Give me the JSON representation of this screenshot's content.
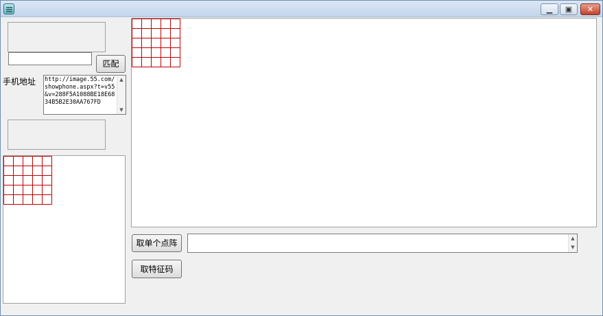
{
  "window": {
    "title": ""
  },
  "controls": {
    "match_button": "匹配",
    "phone_address_label": "手机地址",
    "phone_address_value": "http://image.55.com/showphone.aspx?t=v55&v=288F5A1088BE18E6834B5B2E30AA767FD",
    "top_input_value": "",
    "get_single_matrix_button": "取单个点阵",
    "get_feature_code_button": "取特征码",
    "result_value": ""
  },
  "grids": {
    "main_grid": {
      "rows": 5,
      "cols": 5,
      "color": "#c00000"
    },
    "small_grid": {
      "rows": 5,
      "cols": 5,
      "color": "#c00000"
    }
  },
  "icons": {
    "minimize": "minimize-icon",
    "maximize": "maximize-icon",
    "close": "close-icon"
  }
}
